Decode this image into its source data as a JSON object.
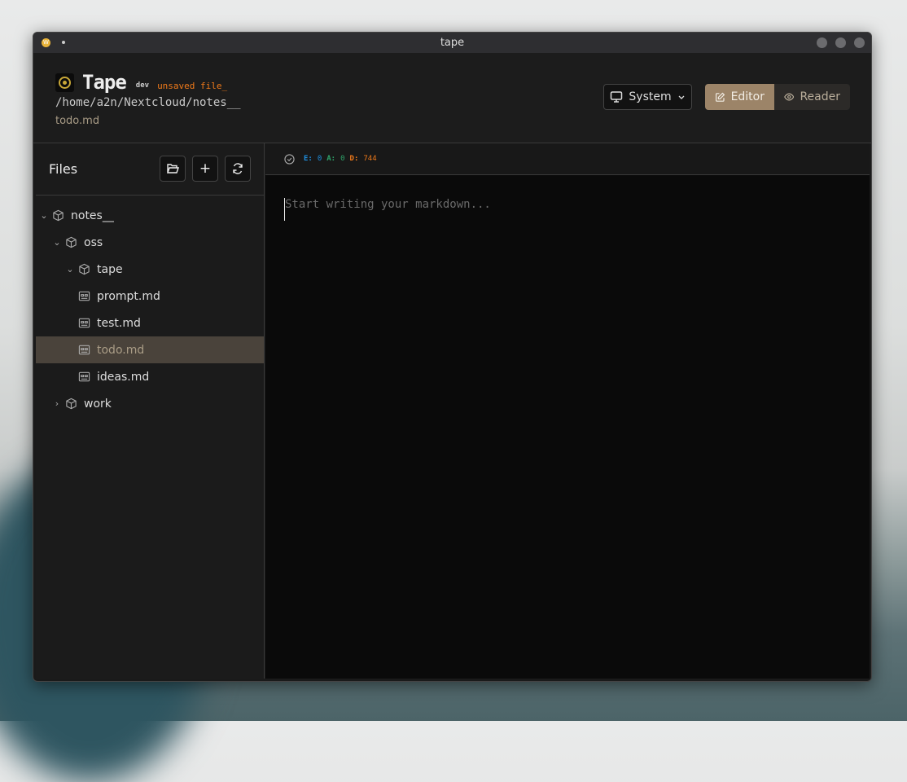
{
  "window": {
    "title": "tape"
  },
  "header": {
    "app_name": "Tape",
    "badge": "dev",
    "unsaved": "unsaved file_",
    "path": "/home/a2n/Nextcloud/notes__",
    "current_file": "todo.md",
    "theme_select": "System",
    "mode_editor": "Editor",
    "mode_reader": "Reader"
  },
  "sidebar": {
    "title": "Files",
    "tree": [
      {
        "label": "notes__",
        "type": "folder",
        "expanded": true
      },
      {
        "label": "oss",
        "type": "folder",
        "expanded": true
      },
      {
        "label": "tape",
        "type": "folder",
        "expanded": true
      },
      {
        "label": "prompt.md",
        "type": "file"
      },
      {
        "label": "test.md",
        "type": "file"
      },
      {
        "label": "todo.md",
        "type": "file",
        "selected": true
      },
      {
        "label": "ideas.md",
        "type": "file"
      },
      {
        "label": "work",
        "type": "folder",
        "expanded": false
      }
    ]
  },
  "status": {
    "e_label": "E:",
    "e_value": "0",
    "a_label": "A:",
    "a_value": "0",
    "d_label": "D:",
    "d_value": "744"
  },
  "editor": {
    "placeholder": "Start writing your markdown..."
  },
  "colors": {
    "accent": "#9c8468",
    "unsaved": "#f07a1a",
    "e": "#1e8fe0",
    "a": "#2ea36a",
    "d": "#f07a1a"
  }
}
